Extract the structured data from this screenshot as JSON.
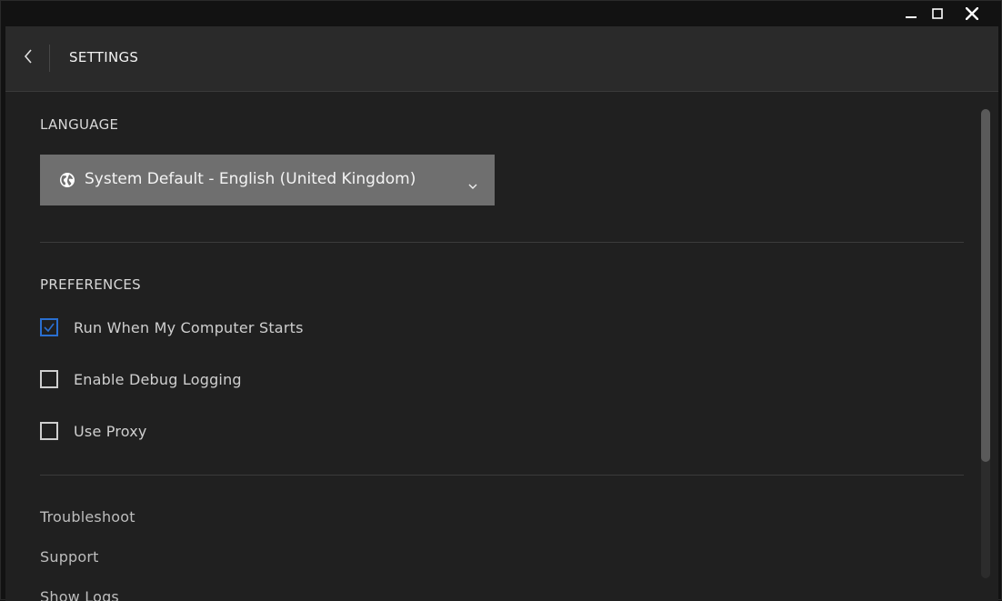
{
  "window": {
    "minimize_icon": "minimize-icon",
    "maximize_icon": "maximize-icon",
    "close_icon": "close-icon"
  },
  "header": {
    "title": "SETTINGS",
    "back_icon": "chevron-left-icon"
  },
  "language": {
    "section_title": "LANGUAGE",
    "selected_value": "System Default - English (United Kingdom)",
    "icon": "globe-icon",
    "dropdown_icon": "chevron-down-icon"
  },
  "preferences": {
    "section_title": "PREFERENCES",
    "options": [
      {
        "label": "Run When My Computer Starts",
        "checked": true
      },
      {
        "label": "Enable Debug Logging",
        "checked": false
      },
      {
        "label": "Use Proxy",
        "checked": false
      }
    ]
  },
  "links": [
    {
      "label": "Troubleshoot"
    },
    {
      "label": "Support"
    },
    {
      "label": "Show Logs"
    }
  ],
  "colors": {
    "background": "#202020",
    "header": "#2a2a2a",
    "select": "#6f6f6f",
    "accent": "#2a6fd0"
  }
}
